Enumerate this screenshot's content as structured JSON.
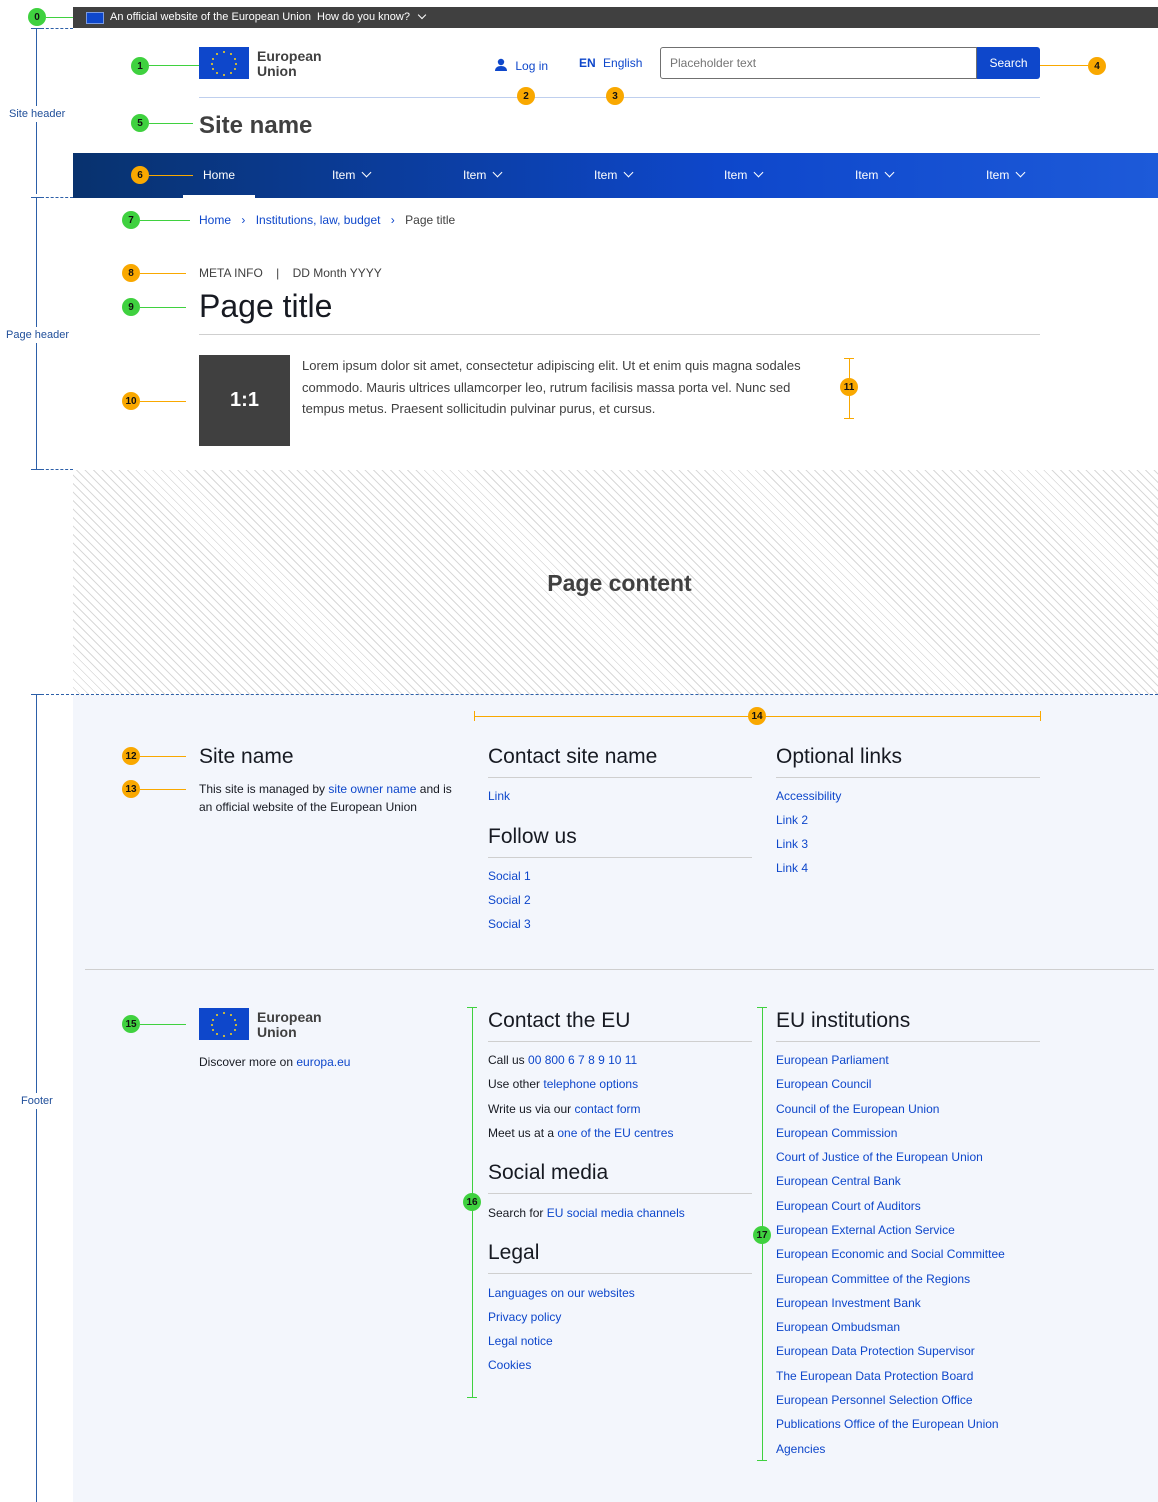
{
  "annotations": {
    "b0": "0",
    "b1": "1",
    "b2": "2",
    "b3": "3",
    "b4": "4",
    "b5": "5",
    "b6": "6",
    "b7": "7",
    "b8": "8",
    "b9": "9",
    "b10": "10",
    "b11": "11",
    "b12": "12",
    "b13": "13",
    "b14": "14",
    "b15": "15",
    "b16": "16",
    "b17": "17",
    "sections": [
      "Site header",
      "Page header",
      "Footer"
    ]
  },
  "top_bar": {
    "flag_icon": "eu-flag-icon",
    "official_text": "An official website of the European Union",
    "how_text": "How do you know?"
  },
  "header": {
    "logo_line1": "European",
    "logo_line2": "Union",
    "login": "Log in",
    "lang_code": "EN",
    "lang_name": "English",
    "search_placeholder": "Placeholder text",
    "search_button": "Search",
    "site_name": "Site name"
  },
  "nav": {
    "items": [
      "Home",
      "Item",
      "Item",
      "Item",
      "Item",
      "Item",
      "Item"
    ]
  },
  "breadcrumb": [
    "Home",
    "Institutions, law, budget",
    "Page title"
  ],
  "page_header": {
    "meta": "META INFO",
    "separator": "|",
    "date": "DD Month YYYY",
    "title": "Page title",
    "image_label": "1:1",
    "description": "Lorem ipsum dolor sit amet, consectetur adipiscing elit. Ut et enim quis magna sodales commodo. Mauris ultrices ullamcorper leo, rutrum facilisis massa porta vel. Nunc sed tempus metus. Praesent sollicitudin pulvinar purus, et cursus."
  },
  "content": {
    "label": "Page content"
  },
  "footer": {
    "site_name": "Site name",
    "managed_pre": "This site is managed by ",
    "managed_link": "site owner name",
    "managed_post": " and is",
    "managed_line2": "an official website of the European Union",
    "contact_title": "Contact site name",
    "contact_link": "Link",
    "follow_title": "Follow us",
    "social": [
      "Social 1",
      "Social 2",
      "Social 3"
    ],
    "optional_title": "Optional links",
    "optional": [
      "Accessibility",
      "Link 2",
      "Link 3",
      "Link 4"
    ],
    "discover_pre": "Discover more on ",
    "discover_link": "europa.eu",
    "contact_eu_title": "Contact the EU",
    "call_pre": "Call us ",
    "call_link": "00 800 6 7 8 9 10 11",
    "use_pre": "Use other ",
    "use_link": "telephone options",
    "write_pre": "Write us via our ",
    "write_link": "contact form",
    "meet_pre": "Meet us at a ",
    "meet_link": "one of the EU centres",
    "social_title": "Social media",
    "search_pre": "Search for ",
    "search_link": "EU social media channels",
    "legal_title": "Legal",
    "legal": [
      "Languages on our websites",
      "Privacy policy",
      "Legal notice",
      "Cookies"
    ],
    "inst_title": "EU institutions",
    "institutions": [
      "European Parliament",
      "European Council",
      "Council of the European Union",
      "European Commission",
      "Court of Justice of the European Union",
      "European Central Bank",
      "European Court of Auditors",
      "European External Action Service",
      "European Economic and Social Committee",
      "European Committee of the Regions",
      "European Investment Bank",
      "European Ombudsman",
      "European Data Protection Supervisor",
      "The European Data Protection Board",
      "European Personnel Selection Office",
      "Publications Office of the European Union",
      "Agencies"
    ]
  }
}
